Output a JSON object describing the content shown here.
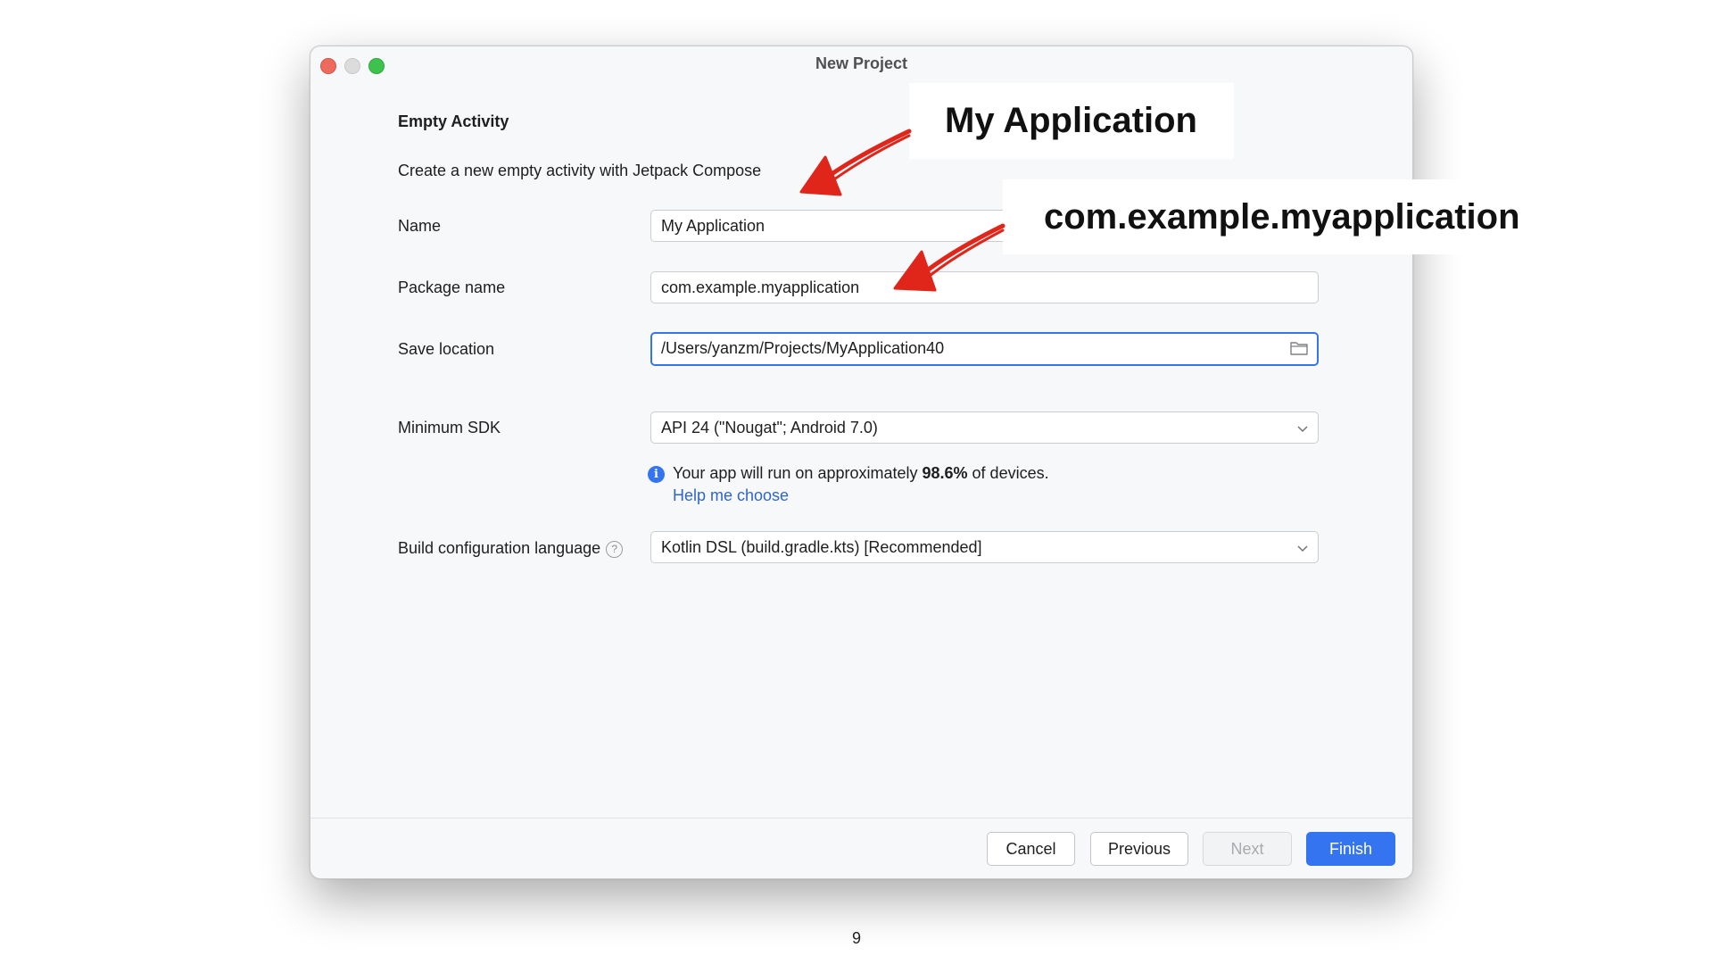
{
  "window": {
    "title": "New Project"
  },
  "form": {
    "heading": "Empty Activity",
    "description": "Create a new empty activity with Jetpack Compose",
    "name": {
      "label": "Name",
      "value": "My Application"
    },
    "package": {
      "label": "Package name",
      "value": "com.example.myapplication"
    },
    "save_location": {
      "label": "Save location",
      "value": "/Users/yanzm/Projects/MyApplication40"
    },
    "min_sdk": {
      "label": "Minimum SDK",
      "value": "API 24 (\"Nougat\"; Android 7.0)"
    },
    "info": {
      "text_before": "Your app will run on approximately ",
      "percent": "98.6%",
      "text_after": " of devices.",
      "help_link": "Help me choose"
    },
    "build_language": {
      "label": "Build configuration language",
      "value": "Kotlin DSL (build.gradle.kts) [Recommended]"
    }
  },
  "buttons": {
    "cancel": "Cancel",
    "previous": "Previous",
    "next": "Next",
    "finish": "Finish"
  },
  "annotations": {
    "callout_name": "My Application",
    "callout_package": "com.example.myapplication",
    "arrow_color": "#e0261b"
  },
  "slide": {
    "page_number": "9"
  },
  "colors": {
    "accent": "#3574f0",
    "link": "#2f65ca"
  }
}
